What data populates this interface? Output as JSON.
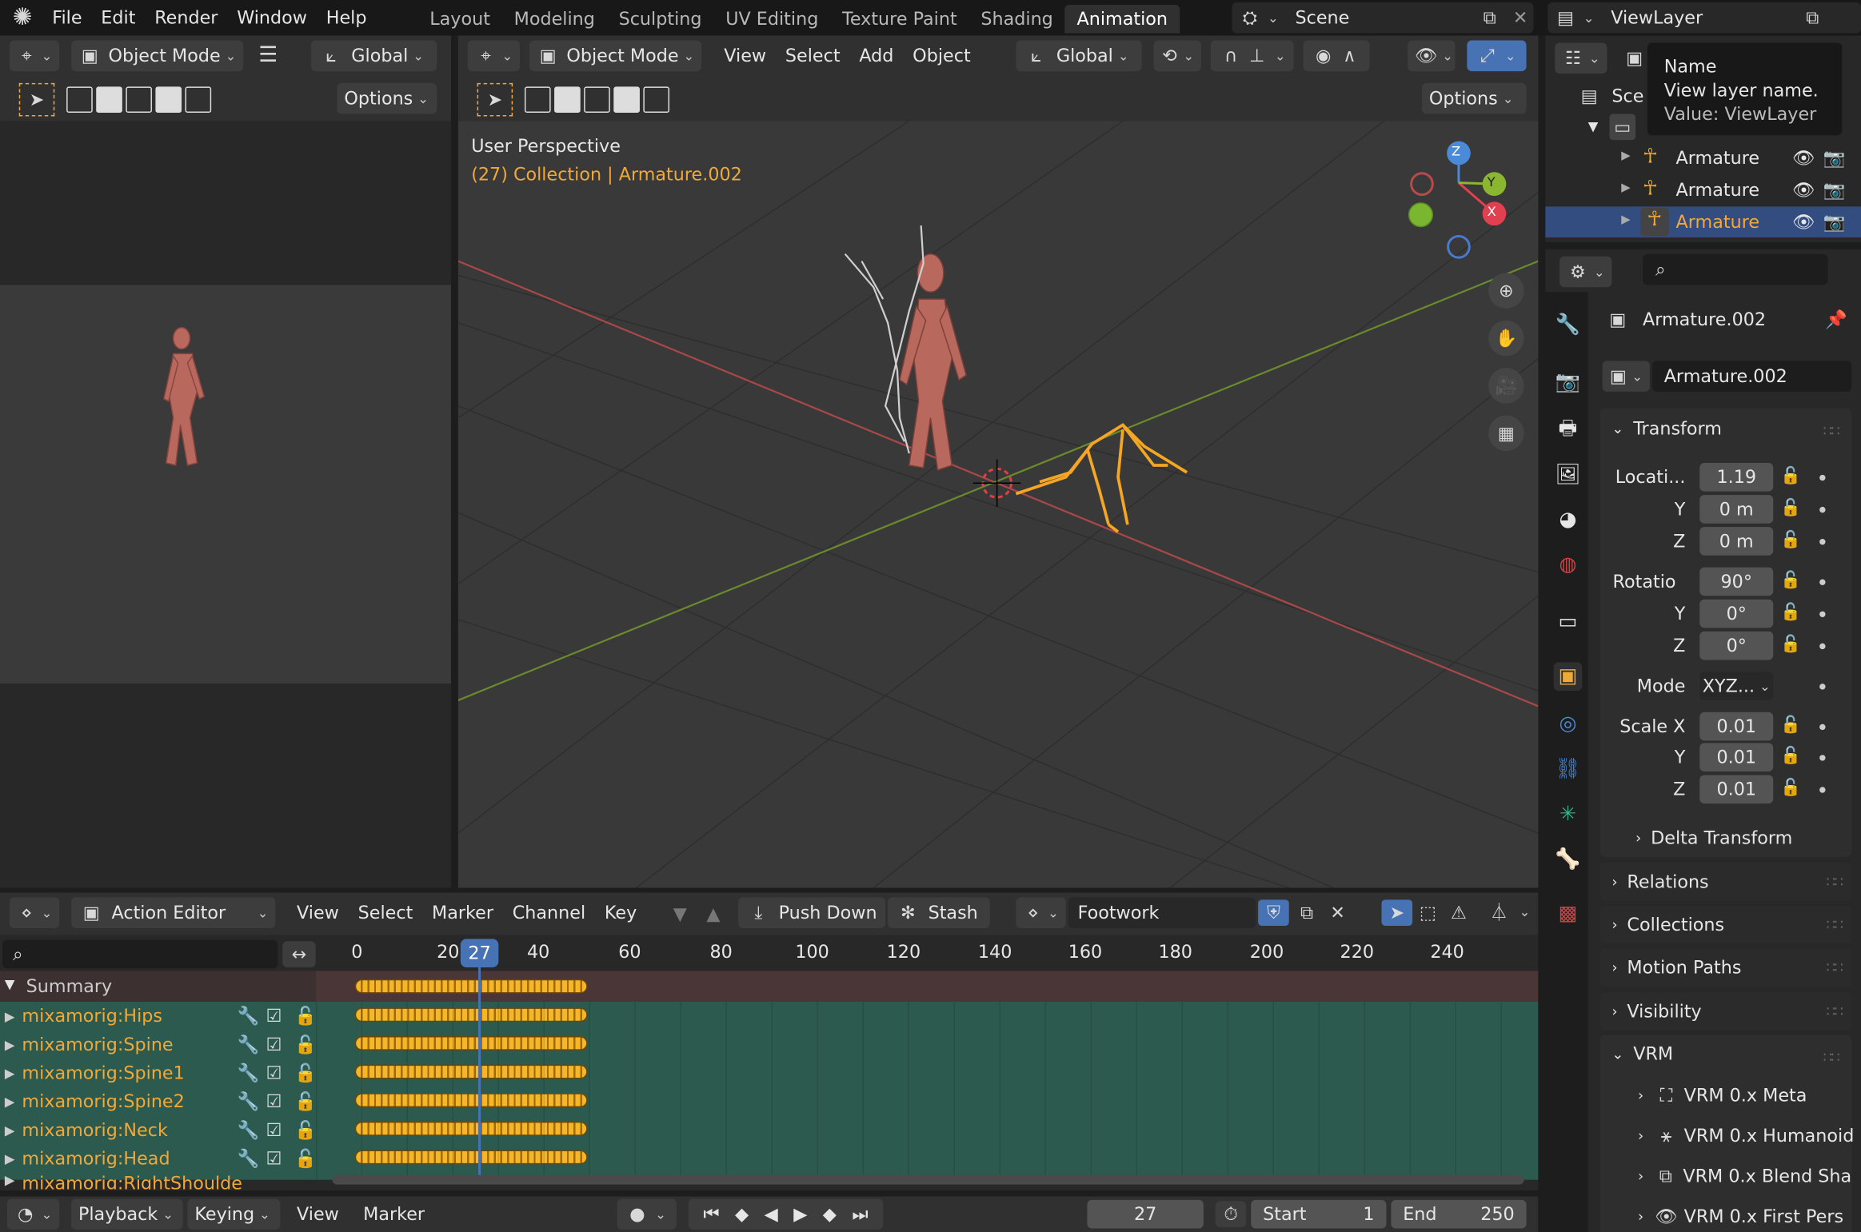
{
  "topbar": {
    "menus": [
      "File",
      "Edit",
      "Render",
      "Window",
      "Help"
    ],
    "workspaces": [
      "Layout",
      "Modeling",
      "Sculpting",
      "UV Editing",
      "Texture Paint",
      "Shading",
      "Animation"
    ],
    "active_workspace": "Animation",
    "scene": "Scene",
    "view_layer": "ViewLayer"
  },
  "tooltip": {
    "line1": "Name",
    "line2": "View layer name.",
    "line3": "Value: ViewLayer"
  },
  "left_view": {
    "mode": "Object Mode",
    "orientation": "Global",
    "options": "Options"
  },
  "viewport": {
    "mode": "Object Mode",
    "menus": [
      "View",
      "Select",
      "Add",
      "Object"
    ],
    "orientation": "Global",
    "options": "Options",
    "title": "User Perspective",
    "subtitle": "(27) Collection | Armature.002",
    "gizmo_z": "Z",
    "gizmo_y": "Y",
    "gizmo_x": "X"
  },
  "outliner": {
    "scene_label": "Sce",
    "items": [
      "Armature",
      "Armature",
      "Armature"
    ]
  },
  "properties": {
    "object_name": "Armature.002",
    "data_name": "Armature.002",
    "transform_label": "Transform",
    "location_label": "Locati...",
    "loc": [
      "1.19",
      "0 m",
      "0 m"
    ],
    "rotation_label": "Rotatio",
    "rot": [
      "90°",
      "0°",
      "0°"
    ],
    "y_label": "Y",
    "z_label": "Z",
    "mode_label": "Mode",
    "mode_value": "XYZ...",
    "scale_label": "Scale X",
    "scale": [
      "0.01",
      "0.01",
      "0.01"
    ],
    "delta": "Delta Transform",
    "sections": [
      "Relations",
      "Collections",
      "Motion Paths",
      "Visibility"
    ],
    "vrm": "VRM",
    "vrm_items": [
      "VRM 0.x Meta",
      "VRM 0.x Humanoid",
      "VRM 0.x Blend Sha",
      "VRM 0.x First Pers"
    ]
  },
  "action_editor": {
    "mode": "Action Editor",
    "menus": [
      "View",
      "Select",
      "Marker",
      "Channel",
      "Key"
    ],
    "push_down": "Push Down",
    "stash": "Stash",
    "action": "Footwork",
    "ticks": [
      "0",
      "20",
      "40",
      "60",
      "80",
      "100",
      "120",
      "140",
      "160",
      "180",
      "200",
      "220",
      "240"
    ],
    "current_frame": "27",
    "summary": "Summary",
    "channels": [
      "mixamorig:Hips",
      "mixamorig:Spine",
      "mixamorig:Spine1",
      "mixamorig:Spine2",
      "mixamorig:Neck",
      "mixamorig:Head",
      "mixamorig:RightShoulde"
    ]
  },
  "timeline": {
    "menus": [
      "Playback",
      "Keying",
      "View",
      "Marker"
    ],
    "frame": "27",
    "start_label": "Start",
    "start": "1",
    "end_label": "End",
    "end": "250"
  },
  "colors": {
    "accent": "#4772b3",
    "orange": "#f0a838",
    "selected": "#f5a623"
  }
}
